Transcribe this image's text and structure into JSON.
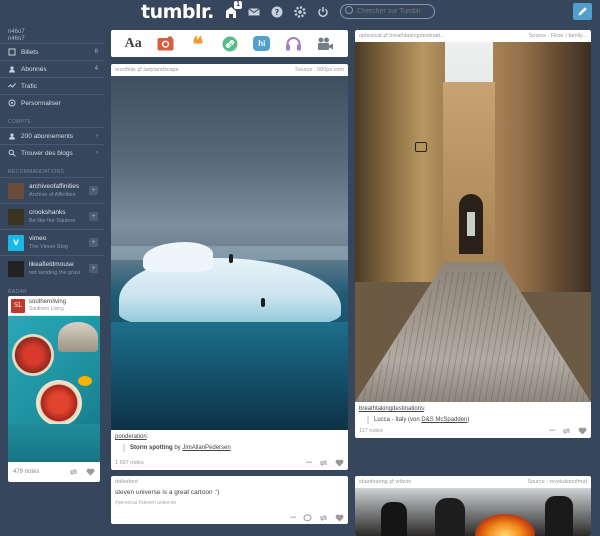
{
  "header": {
    "logo": "tumblr.",
    "inbox_badge": "1",
    "search_placeholder": "Chercher sur Tumblr"
  },
  "sidebar": {
    "account_name": "n46o7",
    "account_sub": "n46o7",
    "items": [
      {
        "label": "Billets",
        "count": "8"
      },
      {
        "label": "Abonnés",
        "count": "4"
      },
      {
        "label": "Trafic",
        "count": ""
      },
      {
        "label": "Personnaliser",
        "count": ""
      }
    ],
    "section_compte": "COMPTE",
    "account_items": [
      {
        "label": "200 abonnements",
        "count": ""
      },
      {
        "label": "Trouver des blogs",
        "count": ""
      }
    ],
    "section_recommended": "RECOMMANDATIONS",
    "blogs": [
      {
        "name": "archiveofaffinities",
        "sub": "Archive of Affinities",
        "color": "#6b4a3a"
      },
      {
        "name": "crookshanks",
        "sub": "Be like the Squirrel",
        "color": "#3d3322"
      },
      {
        "name": "vimeo",
        "sub": "The Vimeo Blog",
        "color": "#1ab7ea"
      },
      {
        "name": "likeafieldmouse",
        "sub": "not sending the gravi",
        "color": "#222222"
      }
    ],
    "section_radar": "RADAR",
    "radar": {
      "blog": "southernliving",
      "sub": "Southern Living",
      "notes": "479 notes"
    }
  },
  "post_bar": {
    "types": [
      {
        "name": "text",
        "label": "Aa",
        "color": "#444444"
      },
      {
        "name": "photo",
        "label": "",
        "color": "#d95e40"
      },
      {
        "name": "quote",
        "label": "❝",
        "color": "#f2992e"
      },
      {
        "name": "link",
        "label": "",
        "color": "#56bc8a"
      },
      {
        "name": "chat",
        "label": "hi",
        "color": "#529ecc"
      },
      {
        "name": "audio",
        "label": "",
        "color": "#a77dc2"
      },
      {
        "name": "video",
        "label": "",
        "color": "#748089"
      }
    ]
  },
  "posts": {
    "iceberg": {
      "author": "oroofelis",
      "reblogged_from": "ladylandscape",
      "source": "Source : 500px.com",
      "caption_blog": "ponderation",
      "quote_title": "Storm spotting",
      "quote_by": "by",
      "quote_author": "JimAllanPedersen",
      "notes": "1 697 notes"
    },
    "lucca": {
      "author": "opticsical",
      "reblogged_from": "breathtakingdestinati...",
      "source": "Source : Flickr / family...",
      "caption_blog": "breathtakingdestinations",
      "quote_text": "Lucca - Italy (von",
      "quote_link": "D&S McSpadden",
      "quote_close": ")",
      "notes": "117 notes"
    },
    "steven": {
      "author": "dolbebert",
      "text": "steven universe is a great cartoon :')",
      "tags": "#personal  #steven universe"
    },
    "protest": {
      "author": "shantiraring",
      "reblogged_from": "vribvie",
      "source": "Source : revolutionofmat"
    }
  }
}
